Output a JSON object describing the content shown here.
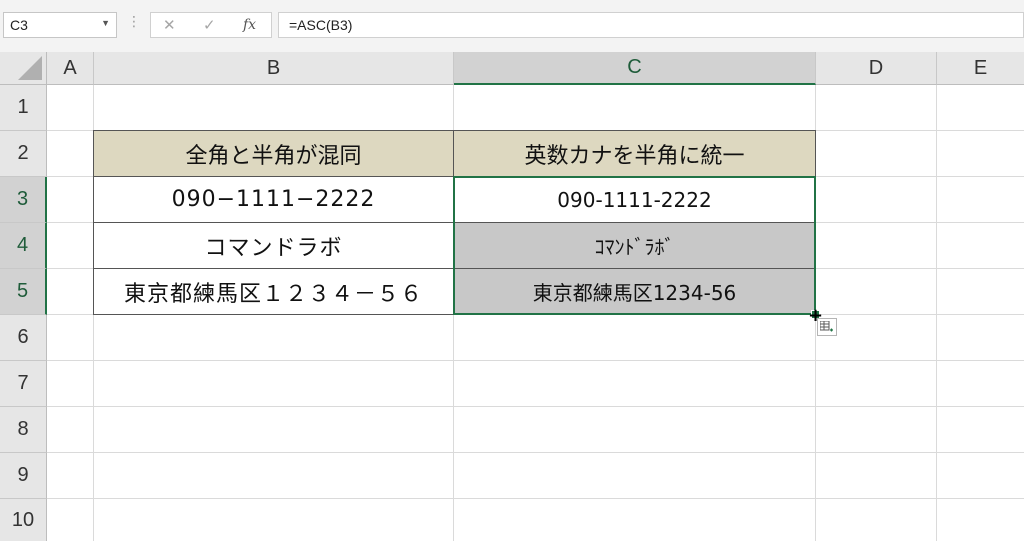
{
  "name_box": "C3",
  "formula": "=ASC(B3)",
  "toolbar": {
    "dots": "⋮",
    "cancel": "✕",
    "enter": "✓",
    "fx": "fx"
  },
  "columns": [
    "A",
    "B",
    "C",
    "D",
    "E"
  ],
  "rows": [
    "1",
    "2",
    "3",
    "4",
    "5",
    "6",
    "7",
    "8",
    "9",
    "10"
  ],
  "selected_column": "C",
  "selected_rows": [
    "3",
    "4",
    "5"
  ],
  "cells": {
    "B2": "全角と半角が混同",
    "C2": "英数カナを半角に統一",
    "B3": "090−1111−2222",
    "C3": "090-1111-2222",
    "B4": "コマンドラボ",
    "C4": "ｺﾏﾝﾄﾞﾗﾎﾞ",
    "B5": "東京都練馬区１２３４－５６",
    "C5": "東京都練馬区1234-56"
  },
  "colors": {
    "header_fill": "#ddd8c0",
    "selected_accent": "#217346",
    "filled_cell": "#c8c8c8"
  }
}
